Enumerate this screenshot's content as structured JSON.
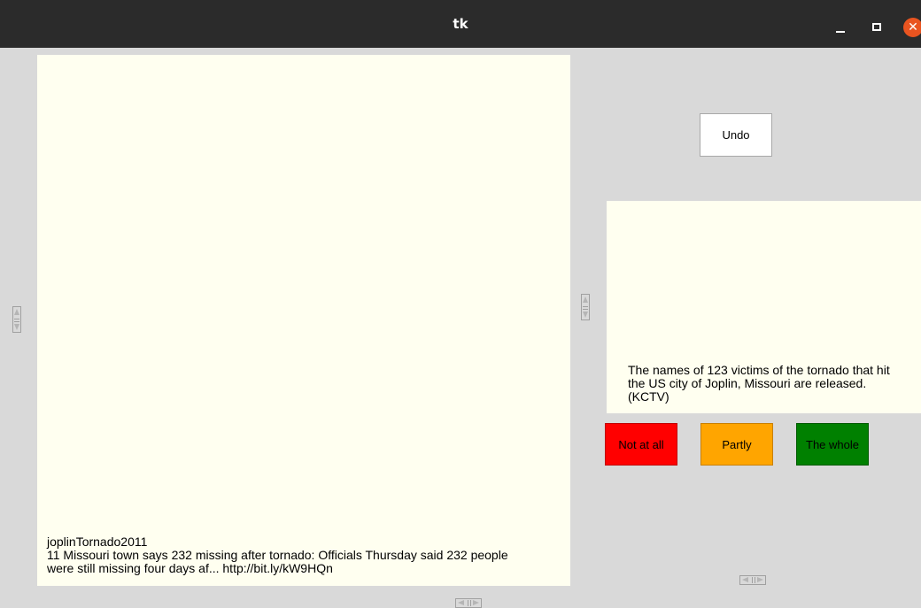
{
  "window": {
    "title": "tk",
    "controls": [
      "minimize-icon",
      "maximize-icon",
      "close-icon"
    ],
    "close_glyph": "✕",
    "colors": {
      "titlebar": "#2b2b2b",
      "close": "#e95420",
      "background": "#d9d9d9"
    }
  },
  "left_panel": {
    "text_lines": [
      "joplinTornado2011",
      "11 Missouri town says 232 missing after tornado: Officials Thursday said 232 people",
      "were still missing four days af... http://bit.ly/kW9HQn"
    ],
    "background": "#fffff0"
  },
  "right_panel": {
    "text_lines": [
      "The names of 123 victims of the tornado that hit",
      "the US city of Joplin, Missouri are released.",
      "(KCTV)"
    ],
    "background": "#fffff0"
  },
  "buttons": {
    "undo": "Undo",
    "not_at_all": "Not at all",
    "partly": "Partly",
    "the_whole": "The whole"
  },
  "button_colors": {
    "undo": "#ffffff",
    "not_at_all": "#ff0000",
    "partly": "#ffa500",
    "the_whole": "#008000"
  }
}
